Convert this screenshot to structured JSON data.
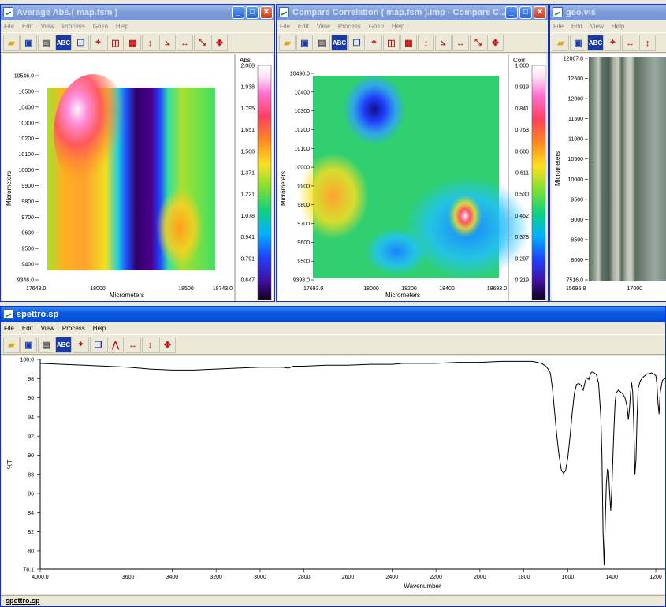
{
  "windows": {
    "avg": {
      "title": "Average Abs.( map.fsm )",
      "menu": [
        "File",
        "Edit",
        "View",
        "Process",
        "GoTo",
        "Help"
      ],
      "ylabel": "Micrometers",
      "xlabel": "Micrometers",
      "yticks": [
        "10546.0",
        "10500",
        "10400",
        "10300",
        "10200",
        "10100",
        "10000",
        "9900",
        "9800",
        "9700",
        "9600",
        "9500",
        "9400",
        "9346.0"
      ],
      "xticks": [
        "17643.0",
        "18000",
        "18500",
        "18743.0"
      ],
      "scale_title": "Abs.",
      "scale_values": [
        "2.088",
        "1.938",
        "1.795",
        "1.651",
        "1.508",
        "1.371",
        "1.221",
        "1.078",
        "0.941",
        "0.791",
        "0.647"
      ]
    },
    "corr": {
      "title": "Compare Correlation ( map.fsm ).imp - Compare C...",
      "menu": [
        "File",
        "Edit",
        "View",
        "Process",
        "GoTo",
        "Help"
      ],
      "ylabel": "Micrometers",
      "xlabel": "Micrometers",
      "yticks": [
        "10498.0",
        "10400",
        "10300",
        "10200",
        "10100",
        "10000",
        "9900",
        "9800",
        "9700",
        "9600",
        "9500",
        "9398.0"
      ],
      "xticks": [
        "17693.0",
        "18000",
        "18200",
        "18400",
        "18693.0"
      ],
      "scale_title": "Corr",
      "scale_values": [
        "1.000",
        "0.919",
        "0.841",
        "0.763",
        "0.686",
        "0.611",
        "0.530",
        "0.452",
        "0.378",
        "0.297",
        "0.219"
      ]
    },
    "geo": {
      "title": "geo.vis",
      "menu": [
        "File",
        "Edit",
        "View",
        "Help"
      ],
      "ylabel": "Micrometers",
      "yticks": [
        "12867.8",
        "12500",
        "12000",
        "11500",
        "11000",
        "10500",
        "10000",
        "9500",
        "9000",
        "8500",
        "8000",
        "7516.0"
      ],
      "xticks": [
        "15695.8",
        "17000"
      ]
    },
    "spectro": {
      "title": "spettro.sp",
      "menu": [
        "File",
        "Edit",
        "View",
        "Process",
        "Help"
      ],
      "status": "spettro.sp"
    }
  },
  "chart_data": {
    "type": "line",
    "xlabel": "Wavenumber",
    "ylabel": "%T",
    "xlim": [
      4000.0,
      1150
    ],
    "ylim": [
      78.1,
      100.0
    ],
    "xticks": [
      "4000.0",
      "3600",
      "3400",
      "3200",
      "3000",
      "2800",
      "2600",
      "2400",
      "2200",
      "2000",
      "1800",
      "1600",
      "1400",
      "1200"
    ],
    "yticks": [
      "100.0",
      "98",
      "96",
      "94",
      "92",
      "90",
      "88",
      "86",
      "84",
      "82",
      "80",
      "78.1"
    ],
    "series": [
      {
        "x": [
          4000,
          3900,
          3800,
          3700,
          3600,
          3500,
          3400,
          3300,
          3200,
          3100,
          3000,
          2950,
          2900,
          2870,
          2850,
          2800,
          2700,
          2600,
          2500,
          2400,
          2350,
          2300,
          2200,
          2100,
          2000,
          1900,
          1800,
          1760,
          1720,
          1700,
          1690,
          1680,
          1670,
          1660,
          1650,
          1640,
          1630,
          1620,
          1610,
          1600,
          1590,
          1580,
          1570,
          1560,
          1550,
          1540,
          1530,
          1520,
          1515,
          1510,
          1505,
          1500,
          1495,
          1490,
          1480,
          1470,
          1460,
          1450,
          1445,
          1440,
          1435,
          1430,
          1425,
          1420,
          1415,
          1410,
          1405,
          1400,
          1395,
          1390,
          1385,
          1380,
          1370,
          1360,
          1350,
          1340,
          1330,
          1325,
          1320,
          1315,
          1310,
          1305,
          1300,
          1295,
          1290,
          1285,
          1280,
          1270,
          1260,
          1250,
          1240,
          1230,
          1220,
          1210,
          1200,
          1195,
          1190,
          1185,
          1180,
          1170,
          1160,
          1150
        ],
        "y": [
          99.6,
          99.5,
          99.4,
          99.3,
          99.2,
          99.0,
          98.9,
          98.9,
          99.0,
          99.1,
          99.2,
          99.2,
          99.2,
          99.1,
          99.3,
          99.3,
          99.4,
          99.4,
          99.5,
          99.5,
          99.6,
          99.6,
          99.6,
          99.7,
          99.7,
          99.8,
          99.8,
          99.8,
          99.6,
          99.3,
          99.0,
          98.6,
          97.0,
          94.5,
          92.0,
          90.0,
          88.5,
          88.1,
          88.4,
          89.8,
          92.0,
          94.5,
          96.5,
          97.4,
          97.5,
          97.3,
          96.8,
          97.8,
          98.1,
          98.0,
          97.9,
          98.3,
          98.6,
          98.7,
          98.6,
          98.4,
          97.5,
          94.0,
          90.0,
          82.0,
          78.5,
          83.0,
          87.0,
          88.5,
          88.4,
          86.0,
          84.2,
          86.5,
          90.0,
          93.0,
          95.5,
          96.5,
          96.8,
          96.6,
          96.4,
          96.0,
          95.0,
          93.7,
          94.8,
          96.5,
          97.6,
          96.5,
          93.0,
          88.0,
          89.5,
          94.0,
          97.0,
          97.8,
          98.1,
          98.3,
          98.5,
          98.5,
          98.6,
          98.5,
          98.3,
          97.5,
          95.5,
          94.3,
          96.5,
          97.8,
          98.0,
          97.9
        ]
      }
    ],
    "grid": false
  }
}
